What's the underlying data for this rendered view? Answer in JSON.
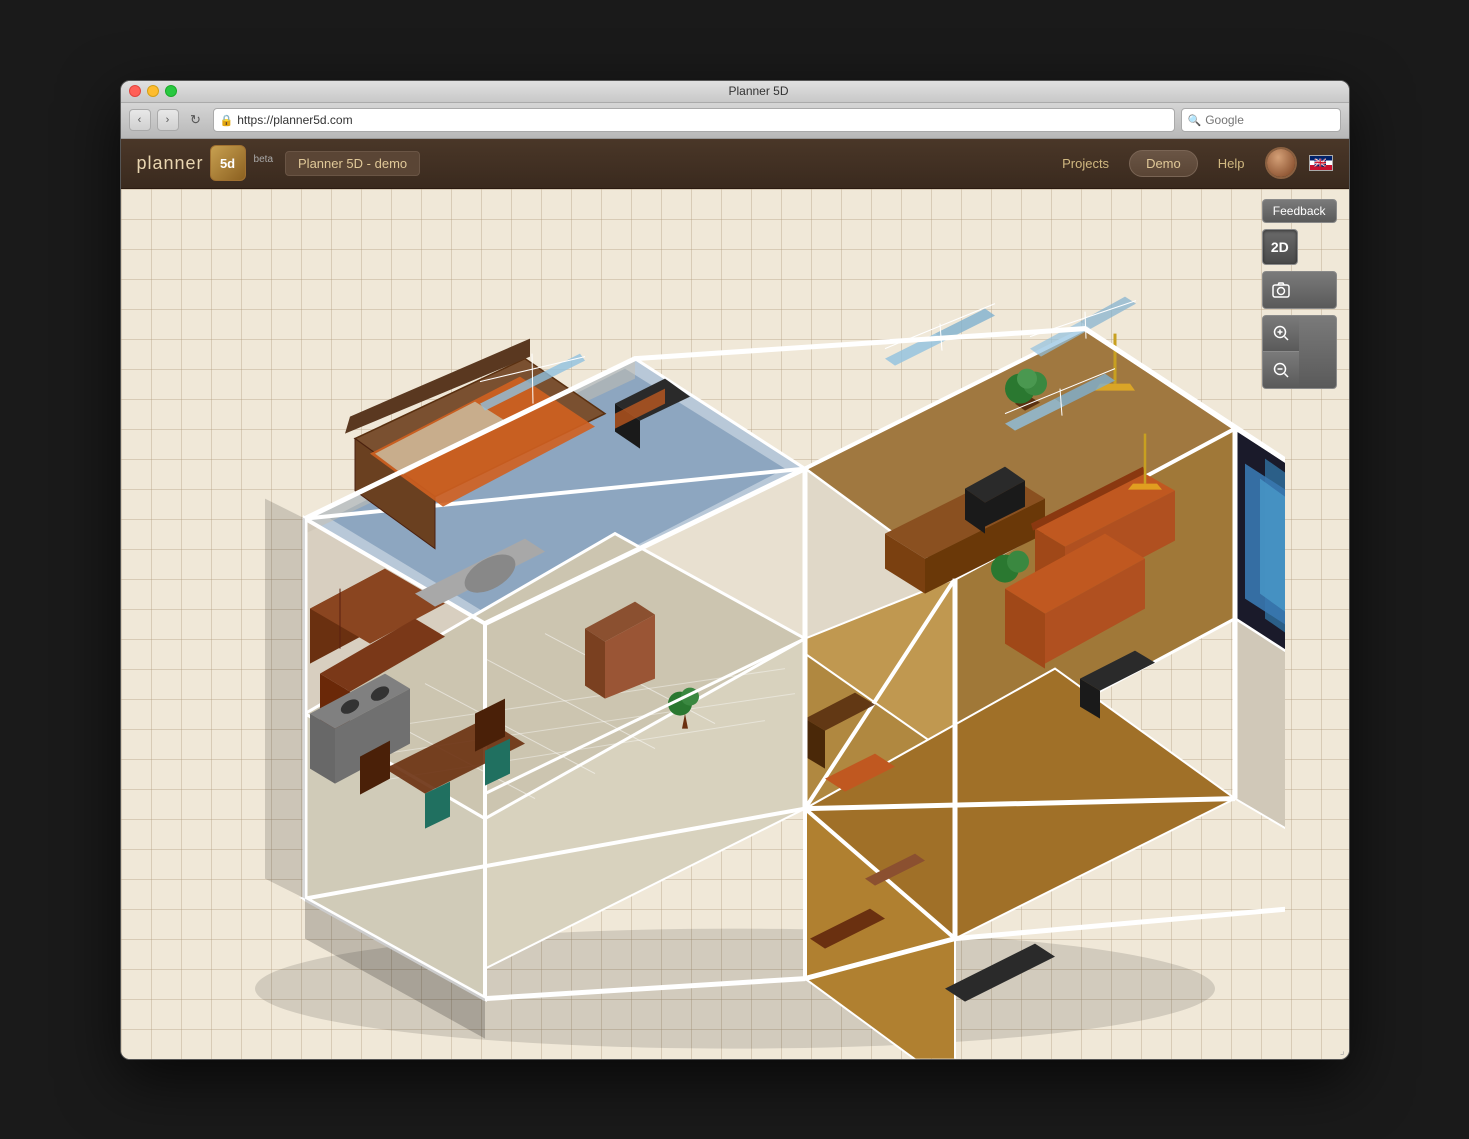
{
  "window": {
    "title": "Planner 5D",
    "controls": {
      "close": "close",
      "minimize": "minimize",
      "maximize": "maximize"
    }
  },
  "browser": {
    "back_label": "‹",
    "forward_label": "›",
    "reload_label": "↻",
    "url": "https://planner5d.com",
    "search_placeholder": "Google"
  },
  "header": {
    "logo_text": "planner",
    "logo_badge": "5d",
    "beta_label": "beta",
    "project_name": "Planner 5D - demo",
    "nav_items": [
      "Projects",
      "Demo",
      "Help"
    ],
    "demo_label": "Demo",
    "projects_label": "Projects",
    "help_label": "Help"
  },
  "toolbar": {
    "feedback_label": "Feedback",
    "view_2d_label": "2D",
    "screenshot_label": "📷",
    "zoom_in_label": "+",
    "zoom_out_label": "–"
  },
  "canvas": {
    "description": "3D isometric view of apartment floor plan with multiple rooms"
  }
}
